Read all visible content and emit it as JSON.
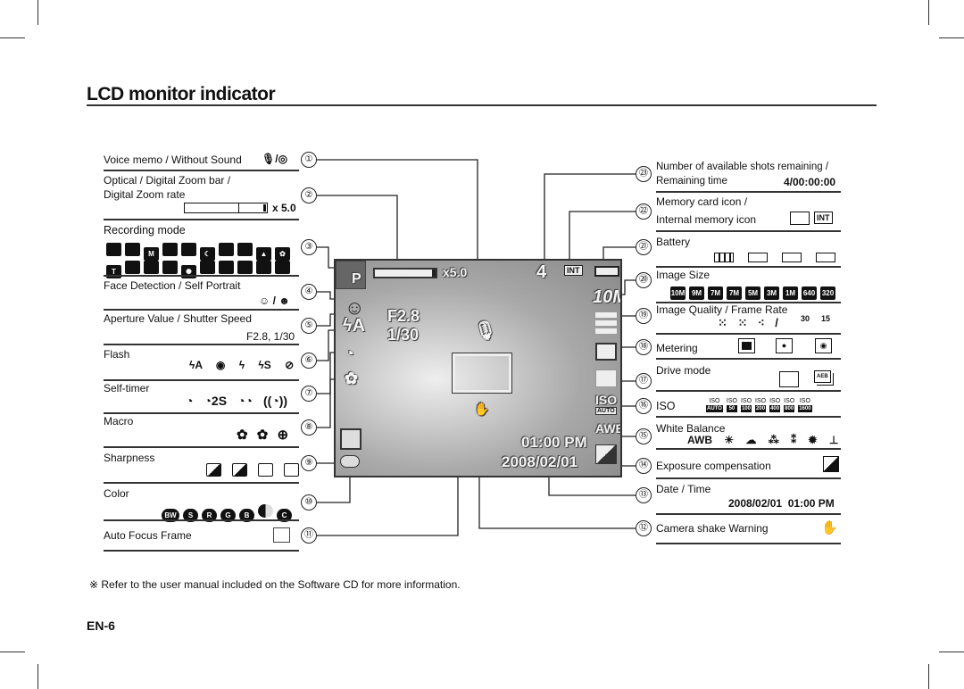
{
  "title": "LCD monitor indicator",
  "left": [
    {
      "n": "①",
      "label": "Voice memo / Without Sound",
      "icons": [
        "microphone-icon",
        "voice-mute-icon"
      ]
    },
    {
      "n": "②",
      "label": "Optical / Digital Zoom bar /",
      "label2": "Digital Zoom rate",
      "value": "x 5.0"
    },
    {
      "n": "③",
      "label": "Recording mode",
      "icons": [
        "auto",
        "program",
        "manual",
        "dis",
        "photo-help",
        "night",
        "portrait",
        "children",
        "landscape",
        "close-up",
        "text",
        "sunset",
        "dawn",
        "backlight",
        "firework",
        "beach-snow",
        "self-shot",
        "food",
        "cafe",
        "movie"
      ]
    },
    {
      "n": "④",
      "label": "Face Detection / Self Portrait"
    },
    {
      "n": "⑤",
      "label": "Aperture Value / Shutter Speed",
      "value": "F2.8, 1/30"
    },
    {
      "n": "⑥",
      "label": "Flash",
      "icons": [
        "ϟA",
        "◉",
        "ϟ",
        "ϟS",
        "⊘"
      ]
    },
    {
      "n": "⑦",
      "label": "Self-timer",
      "icons": [
        "◔",
        "◔2S",
        "◔◔",
        "((◔))"
      ]
    },
    {
      "n": "⑧",
      "label": "Macro",
      "icons": [
        "A✿",
        "✿",
        "⊕"
      ]
    },
    {
      "n": "⑨",
      "label": "Sharpness"
    },
    {
      "n": "⑩",
      "label": "Color",
      "icons": [
        "BW",
        "S",
        "R",
        "G",
        "B",
        "N",
        "C"
      ]
    },
    {
      "n": "⑪",
      "label": "Auto Focus Frame"
    }
  ],
  "right": [
    {
      "n": "㉓",
      "label": "Number of available shots remaining /",
      "label2": "Remaining time",
      "value": "4/00:00:00"
    },
    {
      "n": "㉒",
      "label": "Memory card icon /",
      "label2": "Internal memory icon",
      "icons": [
        "memory-card",
        "INT"
      ]
    },
    {
      "n": "㉑",
      "label": "Battery"
    },
    {
      "n": "⑳",
      "label": "Image Size",
      "icons": [
        "10M",
        "9M",
        "7M",
        "7M",
        "5M",
        "3M",
        "1M",
        "640",
        "320"
      ]
    },
    {
      "n": "⑲",
      "label": "Image Quality / Frame Rate",
      "fps": [
        "30",
        "15"
      ]
    },
    {
      "n": "⑱",
      "label": "Metering"
    },
    {
      "n": "⑰",
      "label": "Drive mode",
      "icons": [
        "single",
        "AEB"
      ]
    },
    {
      "n": "⑯",
      "label": "ISO",
      "iso": [
        "AUTO",
        "50",
        "100",
        "200",
        "400",
        "800",
        "1600"
      ],
      "iso_head": "ISO"
    },
    {
      "n": "⑮",
      "label": "White Balance",
      "icons": [
        "AWB",
        "☀",
        "☁",
        "⁂",
        "⁑",
        "✹",
        "⊥"
      ]
    },
    {
      "n": "⑭",
      "label": "Exposure compensation"
    },
    {
      "n": "⑬",
      "label": "Date / Time",
      "value": "2008/02/01  01:00 PM"
    },
    {
      "n": "⑫",
      "label": "Camera shake Warning"
    }
  ],
  "screen": {
    "mode": "P",
    "zoom": "x5.0",
    "shots": "4",
    "mem": "INT",
    "size": "10M",
    "aperture": "F2.8",
    "shutter": "1/30",
    "time": "01:00 PM",
    "date": "2008/02/01",
    "iso": "ISO",
    "iso_val": "AUTO",
    "wb": "AWB"
  },
  "note": "※ Refer to the user manual included on the Software CD for more information.",
  "page": "EN-6"
}
